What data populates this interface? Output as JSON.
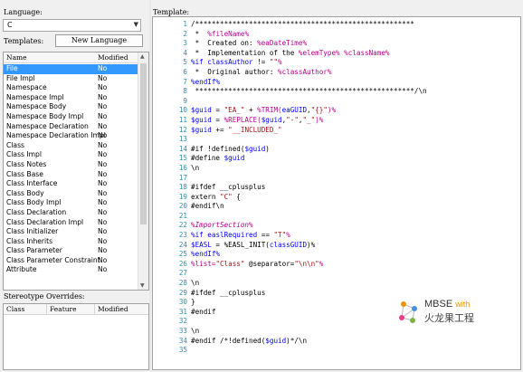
{
  "left": {
    "language_label": "Language:",
    "language_value": "C",
    "templates_label": "Templates:",
    "new_language_button": "New Language",
    "list_headers": [
      "Name",
      "Modified"
    ],
    "templates": [
      {
        "name": "File",
        "modified": "No",
        "selected": true
      },
      {
        "name": "File Impl",
        "modified": "No"
      },
      {
        "name": "Namespace",
        "modified": "No"
      },
      {
        "name": "Namespace Impl",
        "modified": "No"
      },
      {
        "name": "Namespace Body",
        "modified": "No"
      },
      {
        "name": "Namespace Body Impl",
        "modified": "No"
      },
      {
        "name": "Namespace Declaration",
        "modified": "No"
      },
      {
        "name": "Namespace Declaration Impl",
        "modified": "No"
      },
      {
        "name": "Class",
        "modified": "No"
      },
      {
        "name": "Class Impl",
        "modified": "No"
      },
      {
        "name": "Class Notes",
        "modified": "No"
      },
      {
        "name": "Class Base",
        "modified": "No"
      },
      {
        "name": "Class Interface",
        "modified": "No"
      },
      {
        "name": "Class Body",
        "modified": "No"
      },
      {
        "name": "Class Body Impl",
        "modified": "No"
      },
      {
        "name": "Class Declaration",
        "modified": "No"
      },
      {
        "name": "Class Declaration Impl",
        "modified": "No"
      },
      {
        "name": "Class Initializer",
        "modified": "No"
      },
      {
        "name": "Class Inherits",
        "modified": "No"
      },
      {
        "name": "Class Parameter",
        "modified": "No"
      },
      {
        "name": "Class Parameter Constraint",
        "modified": "No"
      },
      {
        "name": "Attribute",
        "modified": "No"
      }
    ],
    "stereotype_label": "Stereotype Overrides:",
    "stereotype_headers": [
      "Class",
      "Feature",
      "Modified"
    ]
  },
  "editor": {
    "label": "Template:",
    "lines": [
      [
        [
          "cm",
          "/*****************************************************"
        ]
      ],
      [
        [
          "cm",
          " *  "
        ],
        [
          "pct",
          "%fileName%"
        ]
      ],
      [
        [
          "cm",
          " *  Created on: "
        ],
        [
          "pct",
          "%eaDateTime%"
        ]
      ],
      [
        [
          "cm",
          " *  Implementation of the "
        ],
        [
          "pct",
          "%elemType%"
        ],
        [
          "cm",
          " "
        ],
        [
          "pct",
          "%className%"
        ]
      ],
      [
        [
          "ppk",
          "%if "
        ],
        [
          "v",
          "classAuthor"
        ],
        [
          "cm",
          " != "
        ],
        [
          "s",
          "\"\""
        ],
        [
          "pct",
          "%"
        ]
      ],
      [
        [
          "cm",
          " *  Original author: "
        ],
        [
          "pct",
          "%classAuthor%"
        ]
      ],
      [
        [
          "ppk",
          "%endIf%"
        ]
      ],
      [
        [
          "cm",
          " *****************************************************/\\n"
        ]
      ],
      [
        [
          "cm",
          ""
        ]
      ],
      [
        [
          "v",
          "$guid"
        ],
        [
          "cm",
          " = "
        ],
        [
          "s",
          "\"EA_\""
        ],
        [
          "cm",
          " + "
        ],
        [
          "fn",
          "%TRIM("
        ],
        [
          "v",
          "eaGUID"
        ],
        [
          "cm",
          ","
        ],
        [
          "s",
          "\"{}\""
        ],
        [
          "fn",
          ")%"
        ]
      ],
      [
        [
          "v",
          "$guid"
        ],
        [
          "cm",
          " = "
        ],
        [
          "fn",
          "%REPLACE("
        ],
        [
          "v",
          "$guid"
        ],
        [
          "cm",
          ","
        ],
        [
          "s",
          "\"-\""
        ],
        [
          "cm",
          ","
        ],
        [
          "s",
          "\"_\""
        ],
        [
          "fn",
          ")%"
        ]
      ],
      [
        [
          "v",
          "$guid"
        ],
        [
          "cm",
          " += "
        ],
        [
          "s",
          "\"__INCLUDED_\""
        ]
      ],
      [
        [
          "cm",
          ""
        ]
      ],
      [
        [
          "cm",
          "#if !defined("
        ],
        [
          "v",
          "$guid"
        ],
        [
          "cm",
          ")"
        ]
      ],
      [
        [
          "cm",
          "#define "
        ],
        [
          "v",
          "$guid"
        ]
      ],
      [
        [
          "cm",
          "\\n"
        ]
      ],
      [
        [
          "cm",
          ""
        ]
      ],
      [
        [
          "cm",
          "#ifdef __cplusplus"
        ]
      ],
      [
        [
          "cm",
          "extern "
        ],
        [
          "s",
          "\"C\""
        ],
        [
          "cm",
          " {"
        ]
      ],
      [
        [
          "cm",
          "#endif\\n"
        ]
      ],
      [
        [
          "cm",
          ""
        ]
      ],
      [
        [
          "mac",
          "%ImportSection%"
        ]
      ],
      [
        [
          "ppk",
          "%if "
        ],
        [
          "v",
          "easlRequired"
        ],
        [
          "cm",
          " == "
        ],
        [
          "s",
          "\"T\""
        ],
        [
          "pct",
          "%"
        ]
      ],
      [
        [
          "v",
          "$EASL"
        ],
        [
          "cm",
          " = %EASL_INIT("
        ],
        [
          "v",
          "classGUID"
        ],
        [
          "cm",
          ")%"
        ]
      ],
      [
        [
          "ppk",
          "%endIf%"
        ]
      ],
      [
        [
          "pct",
          "%list="
        ],
        [
          "s",
          "\"Class\""
        ],
        [
          "cm",
          " @separator="
        ],
        [
          "s",
          "\"\\n\\n\""
        ],
        [
          "pct",
          "%"
        ]
      ],
      [
        [
          "cm",
          ""
        ]
      ],
      [
        [
          "cm",
          "\\n"
        ]
      ],
      [
        [
          "cm",
          "#ifdef __cplusplus"
        ]
      ],
      [
        [
          "cm",
          "}"
        ]
      ],
      [
        [
          "cm",
          "#endif"
        ]
      ],
      [
        [
          "cm",
          ""
        ]
      ],
      [
        [
          "cm",
          "\\n"
        ]
      ],
      [
        [
          "cm",
          "#endif /*!defined("
        ],
        [
          "v",
          "$guid"
        ],
        [
          "cm",
          ")*/\\n"
        ]
      ],
      [
        [
          "cm",
          ""
        ]
      ]
    ]
  },
  "watermark": {
    "line1": "MBSE",
    "line1_suffix": "with",
    "line2": "火龙果工程"
  }
}
